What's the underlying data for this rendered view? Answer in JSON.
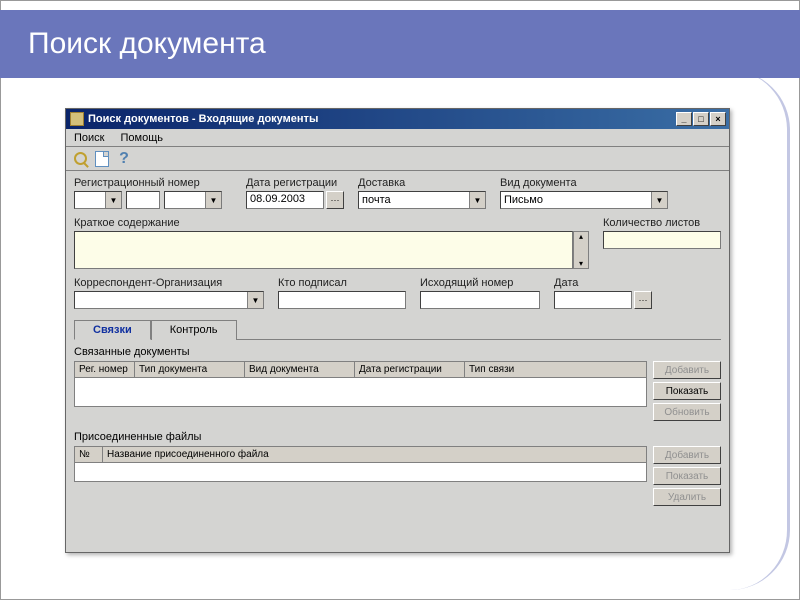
{
  "slide": {
    "title": "Поиск документа"
  },
  "window": {
    "title": "Поиск документов - Входящие документы",
    "menu": {
      "search": "Поиск",
      "help": "Помощь"
    },
    "form": {
      "reg_number_label": "Регистрационный номер",
      "reg_date_label": "Дата регистрации",
      "reg_date_value": "08.09.2003",
      "delivery_label": "Доставка",
      "delivery_value": "почта",
      "doc_type_label": "Вид документа",
      "doc_type_value": "Письмо",
      "summary_label": "Краткое содержание",
      "pages_label": "Количество листов",
      "correspondent_label": "Корреспондент-Организация",
      "signed_by_label": "Кто подписал",
      "outgoing_no_label": "Исходящий номер",
      "date_label": "Дата"
    },
    "tabs": {
      "links": "Связки",
      "control": "Контроль"
    },
    "linked": {
      "title": "Связанные документы",
      "cols": {
        "reg": "Рег. номер",
        "dtype": "Тип документа",
        "kind": "Вид документа",
        "date": "Дата регистрации",
        "link": "Тип связи"
      },
      "buttons": {
        "add": "Добавить",
        "show": "Показать",
        "refresh": "Обновить"
      }
    },
    "files": {
      "title": "Присоединенные файлы",
      "cols": {
        "num": "№",
        "name": "Название присоединенного файла"
      },
      "buttons": {
        "add": "Добавить",
        "show": "Показать",
        "delete": "Удалить"
      }
    }
  }
}
